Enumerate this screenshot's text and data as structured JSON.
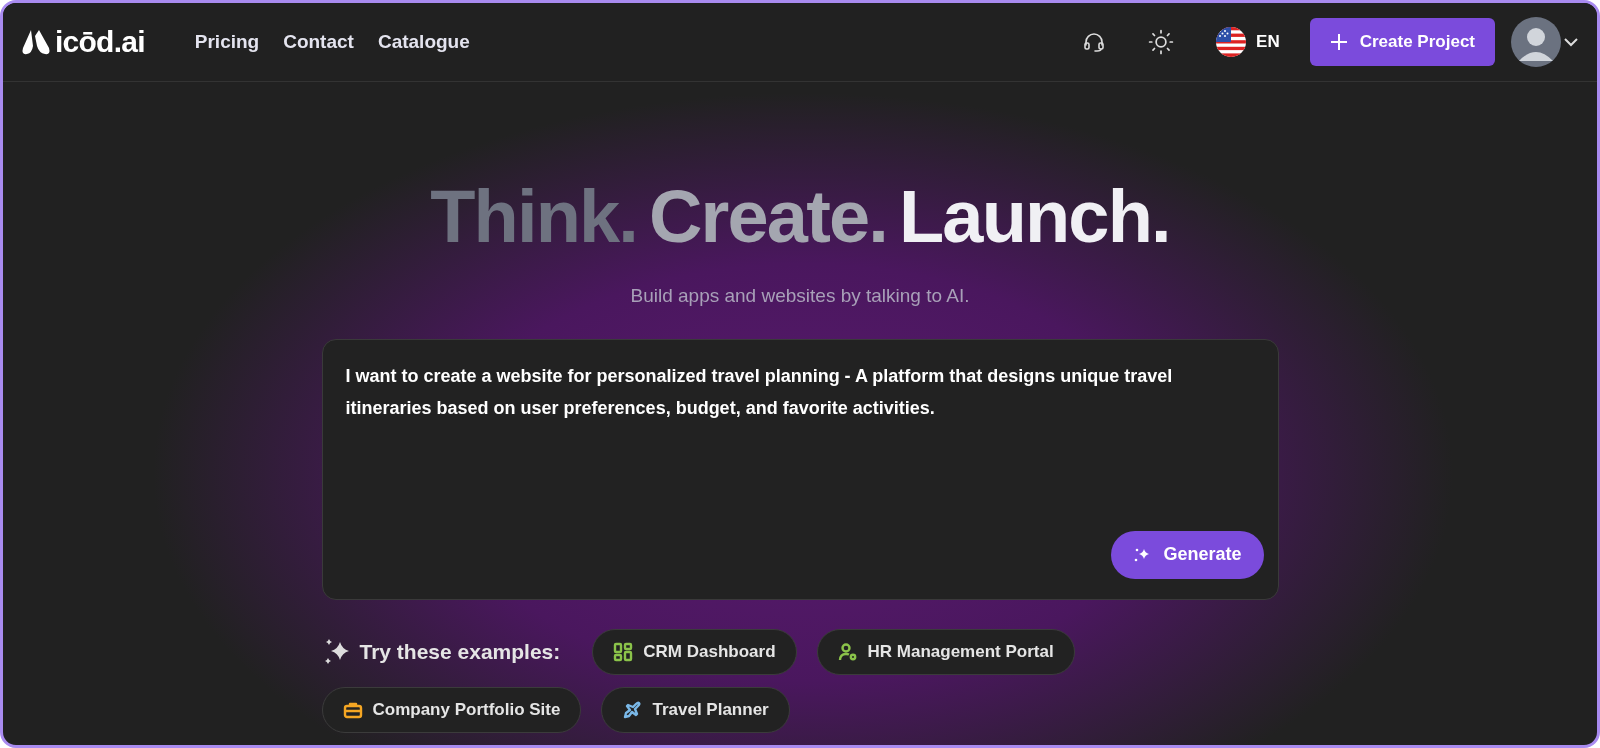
{
  "brand": {
    "logo_text": "icōd.ai"
  },
  "nav": [
    {
      "label": "Pricing"
    },
    {
      "label": "Contact"
    },
    {
      "label": "Catalogue"
    }
  ],
  "language": {
    "code": "EN"
  },
  "create_button": {
    "label": "Create Project"
  },
  "hero": {
    "headline": [
      "Think.",
      "Create.",
      "Launch."
    ],
    "subtitle": "Build apps and websites by talking to AI."
  },
  "prompt": {
    "value": "I want to create a website for personalized travel planning - A platform that designs unique travel itineraries based on user preferences, budget, and favorite activities.",
    "button": "Generate"
  },
  "examples": {
    "label": "Try these examples:",
    "items": [
      {
        "label": "CRM Dashboard",
        "kind": "grid",
        "color": "#8bc34a"
      },
      {
        "label": "HR Management Portal",
        "kind": "user-gear",
        "color": "#8bc34a"
      },
      {
        "label": "Company Portfolio Site",
        "kind": "briefcase",
        "color": "#f5a623"
      },
      {
        "label": "Travel Planner",
        "kind": "plane",
        "color": "#7ab8e8"
      }
    ]
  }
}
